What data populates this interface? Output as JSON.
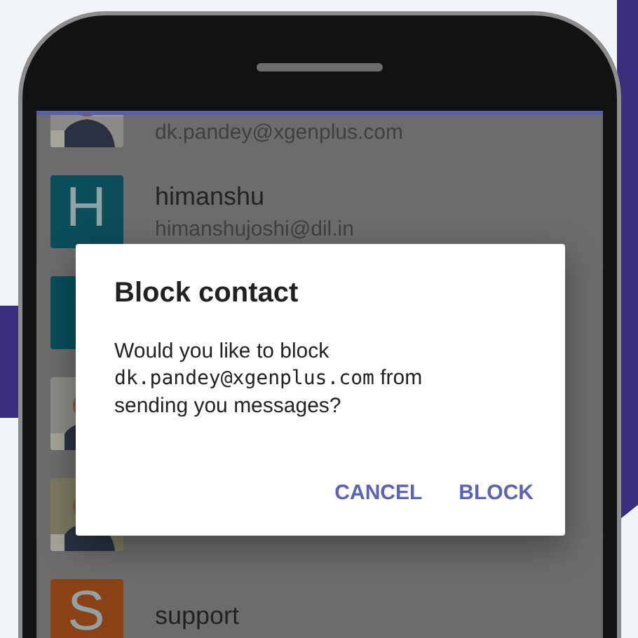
{
  "contacts": [
    {
      "avatar": {
        "kind": "picture"
      },
      "email": "dk.pandey@xgenplus.com"
    },
    {
      "avatar": {
        "kind": "letter",
        "letter": "H",
        "color": "#0b4d59"
      },
      "name": "himanshu",
      "email": "himanshujoshi@dil.in"
    },
    {
      "avatar": {
        "kind": "letter",
        "color": "#0b4d59"
      }
    },
    {
      "avatar": {
        "kind": "picture"
      }
    },
    {
      "avatar": {
        "kind": "picture"
      }
    },
    {
      "avatar": {
        "kind": "letter",
        "letter": "S",
        "color": "#8a4215"
      },
      "name": "support"
    }
  ],
  "dialog": {
    "title": "Block contact",
    "message_before": "Would you like to block",
    "message_email": "dk.pandey@xgenplus.com",
    "message_after": "from sending you messages?",
    "buttons": [
      "CANCEL",
      "BLOCK"
    ]
  }
}
